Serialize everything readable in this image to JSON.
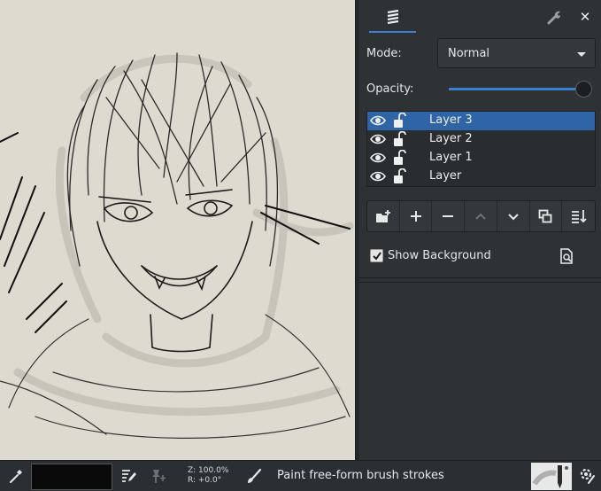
{
  "canvas": {
    "background": "#dddbd0",
    "content": "pencil sketch of a grinning character"
  },
  "panel": {
    "tabs": [
      {
        "name": "layers",
        "icon": "layers-icon",
        "active": true
      },
      {
        "name": "tool-options",
        "icon": "wrench-icon",
        "active": false
      }
    ],
    "close_label": "✕",
    "mode_label": "Mode:",
    "mode_value": "Normal",
    "opacity_label": "Opacity:",
    "opacity": 1.0,
    "layers": [
      {
        "name": "Layer 3",
        "visible": true,
        "locked": false,
        "selected": true
      },
      {
        "name": "Layer 2",
        "visible": true,
        "locked": false,
        "selected": false
      },
      {
        "name": "Layer 1",
        "visible": true,
        "locked": false,
        "selected": false
      },
      {
        "name": "Layer",
        "visible": true,
        "locked": false,
        "selected": false
      }
    ],
    "layer_actions": [
      {
        "name": "new-folder",
        "icon": "folder-add-icon"
      },
      {
        "name": "add-layer",
        "icon": "plus-icon"
      },
      {
        "name": "remove-layer",
        "icon": "minus-icon"
      },
      {
        "name": "move-up",
        "icon": "chevron-up-icon"
      },
      {
        "name": "move-down",
        "icon": "chevron-down-icon"
      },
      {
        "name": "duplicate",
        "icon": "duplicate-icon"
      },
      {
        "name": "merge",
        "icon": "sort-icon"
      }
    ],
    "show_background_label": "Show Background",
    "show_background": true
  },
  "statusbar": {
    "primary_color": "#0a0a0a",
    "zoom_text": "Z: 100.0%",
    "rotation_text": "R: +0.0°",
    "status_text": "Paint free-form brush strokes"
  },
  "colors": {
    "accent": "#3a7fd0",
    "selection": "#2f64a6",
    "panel": "#2e3235"
  }
}
